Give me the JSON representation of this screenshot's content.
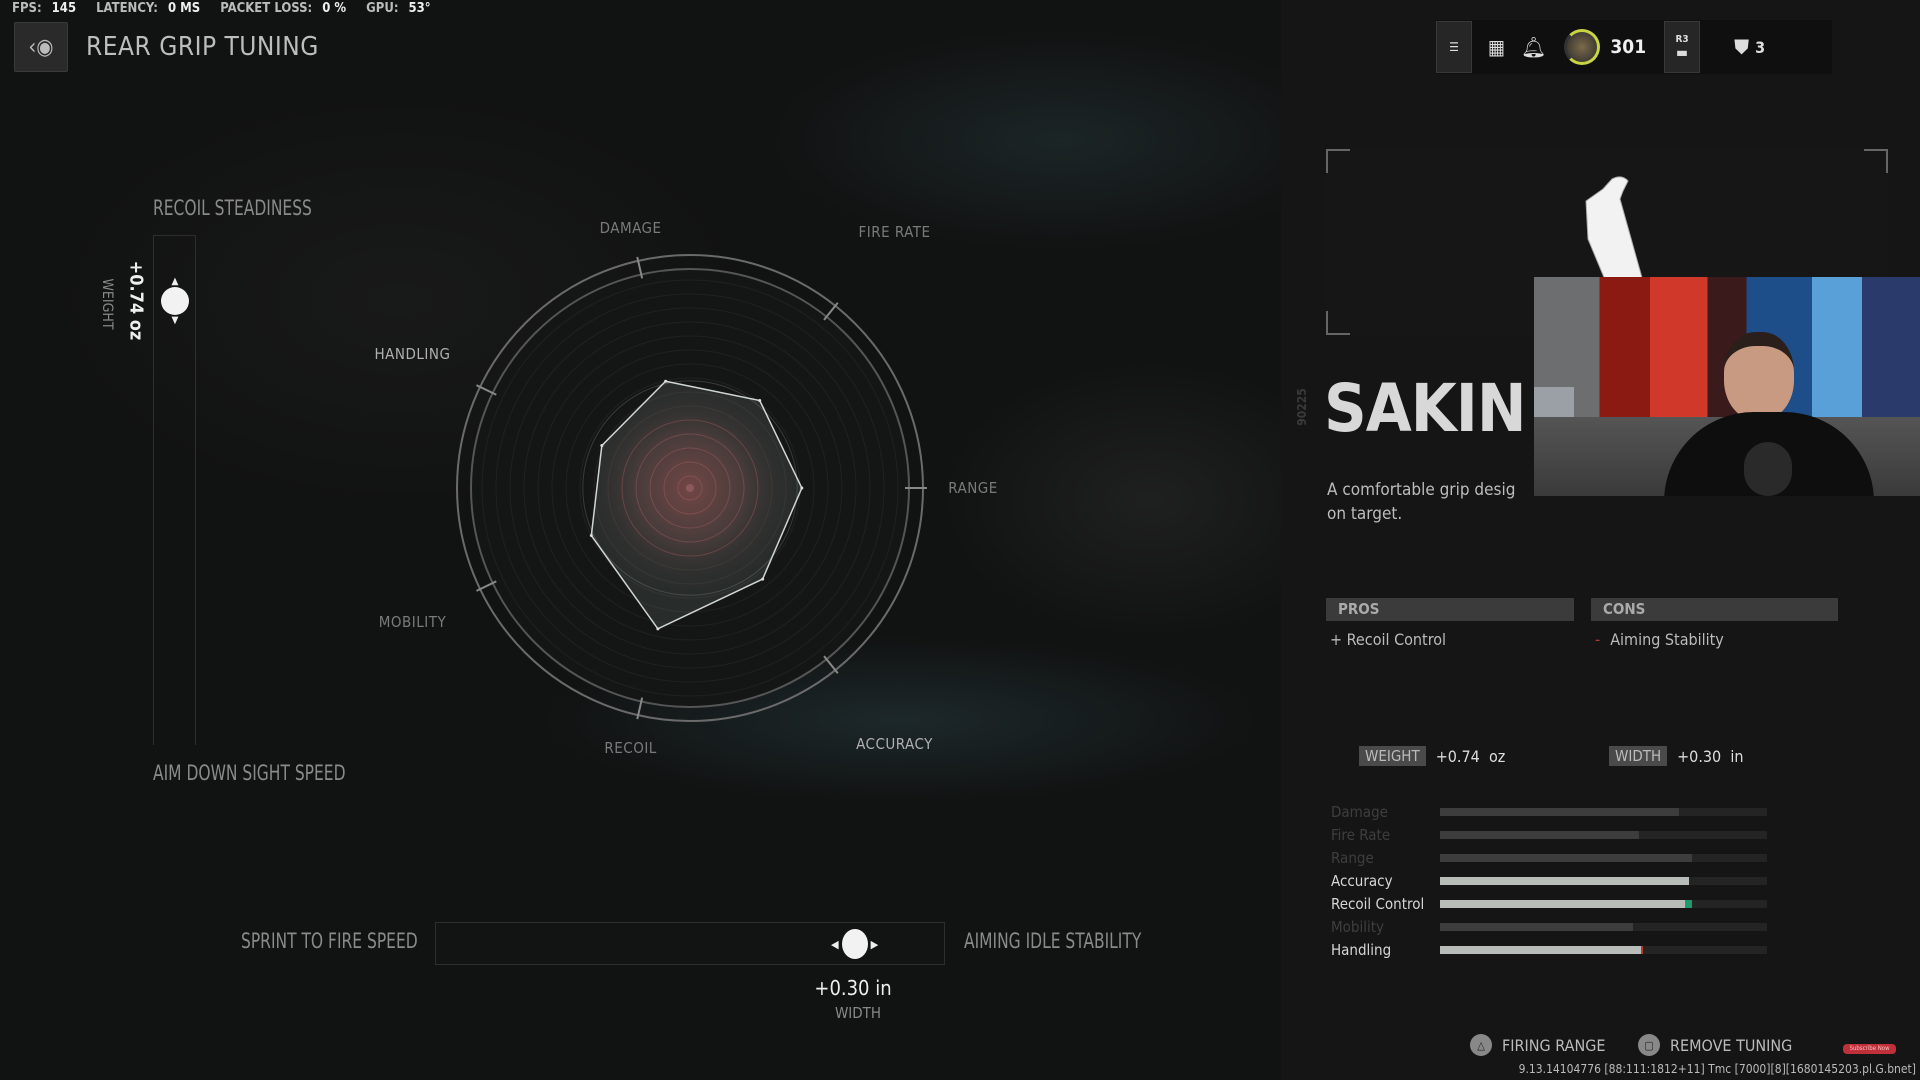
{
  "perf": {
    "fps_label": "FPS:",
    "fps": "145",
    "latency_label": "LATENCY:",
    "latency": "0 MS",
    "packet_label": "PACKET LOSS:",
    "packet": "0 %",
    "gpu_label": "GPU:",
    "gpu": "53°"
  },
  "header": {
    "title": "REAR GRIP TUNING",
    "rank_level": "301",
    "r3_label": "R3",
    "party_count": "3"
  },
  "tuning": {
    "vertical": {
      "top_label": "RECOIL STEADINESS",
      "bottom_label": "AIM DOWN SIGHT SPEED",
      "value": "+0.74 oz",
      "name": "WEIGHT",
      "position": 0.14
    },
    "horizontal": {
      "left_label": "SPRINT TO FIRE SPEED",
      "right_label": "AIMING IDLE STABILITY",
      "value": "+0.30 in",
      "name": "WIDTH",
      "position": 0.83
    }
  },
  "chart_data": {
    "type": "radar",
    "axes": [
      "DAMAGE",
      "FIRE RATE",
      "RANGE",
      "ACCURACY",
      "RECOIL",
      "MOBILITY",
      "HANDLING"
    ],
    "values": [
      47,
      48,
      48,
      50,
      62,
      47,
      42
    ],
    "range": [
      0,
      100
    ],
    "baseline": 46
  },
  "attachment": {
    "code": "90225",
    "name": "SAKIN Z",
    "description_line1": "A comfortable grip desig",
    "description_line2": "on target.",
    "pros_label": "PROS",
    "cons_label": "CONS",
    "pros": [
      "+ Recoil Control"
    ],
    "cons_sign": "-",
    "cons": [
      "Aiming Stability"
    ],
    "weight_label": "WEIGHT",
    "weight_value": "+0.74  oz",
    "width_label": "WIDTH",
    "width_value": "+0.30  in"
  },
  "stats": [
    {
      "name": "Damage",
      "value": 0.73,
      "active": false
    },
    {
      "name": "Fire Rate",
      "value": 0.61,
      "active": false
    },
    {
      "name": "Range",
      "value": 0.77,
      "active": false
    },
    {
      "name": "Accuracy",
      "value": 0.76,
      "active": true
    },
    {
      "name": "Recoil Control",
      "value": 0.75,
      "delta": 0.02,
      "delta_color": "#1f9a6a",
      "active": true
    },
    {
      "name": "Mobility",
      "value": 0.59,
      "active": false
    },
    {
      "name": "Handling",
      "value": 0.62,
      "delta": -0.005,
      "delta_color": "#c0392b",
      "active": true
    }
  ],
  "footer": {
    "firing_range": "FIRING RANGE",
    "remove_tuning": "REMOVE TUNING",
    "subscribe": "Subscribe Now",
    "version": "9.13.14104776 [88:111:1812+11] Tmc [7000][8][1680145203.pl.G.bnet]"
  }
}
